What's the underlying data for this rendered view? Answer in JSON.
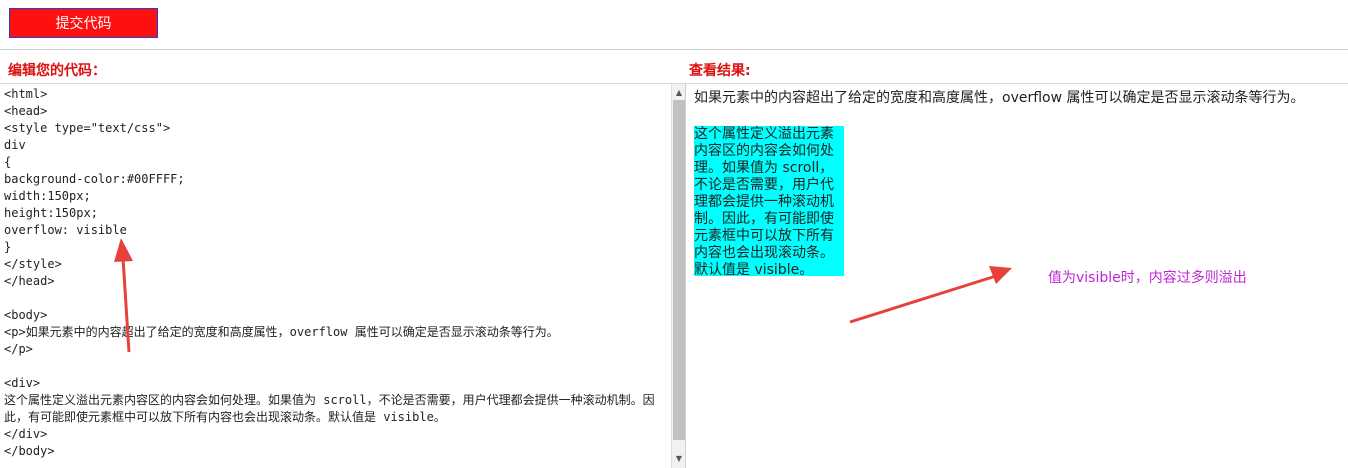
{
  "toolbar": {
    "submit_label": "提交代码"
  },
  "editor": {
    "label": "编辑您的代码：",
    "code": "<html>\n<head>\n<style type=\"text/css\">\ndiv\n{\nbackground-color:#00FFFF;\nwidth:150px;\nheight:150px;\noverflow: visible\n}\n</style>\n</head>\n\n<body>\n<p>如果元素中的内容超出了给定的宽度和高度属性，overflow 属性可以确定是否显示滚动条等行为。\n</p>\n\n<div>\n这个属性定义溢出元素内容区的内容会如何处理。如果值为 scroll，不论是否需要，用户代理都会提供一种滚动机制。因此，有可能即使元素框中可以放下所有内容也会出现滚动条。默认值是 visible。\n</div>\n</body>"
  },
  "result": {
    "label": "查看结果:",
    "paragraph": "如果元素中的内容超出了给定的宽度和高度属性，overflow 属性可以确定是否显示滚动条等行为。",
    "div_text": "这个属性定义溢出元素内容区的内容会如何处理。如果值为 scroll，不论是否需要，用户代理都会提供一种滚动机制。因此，有可能即使元素框中可以放下所有内容也会出现滚动条。默认值是 visible。",
    "div_bg": "#00FFFF"
  },
  "annotation": {
    "text": "值为visible时，内容过多则溢出",
    "color": "#c026d3",
    "arrow_color": "#e8413c"
  },
  "colors": {
    "button_bg": "#ff1010",
    "label_color": "#dd1111"
  }
}
